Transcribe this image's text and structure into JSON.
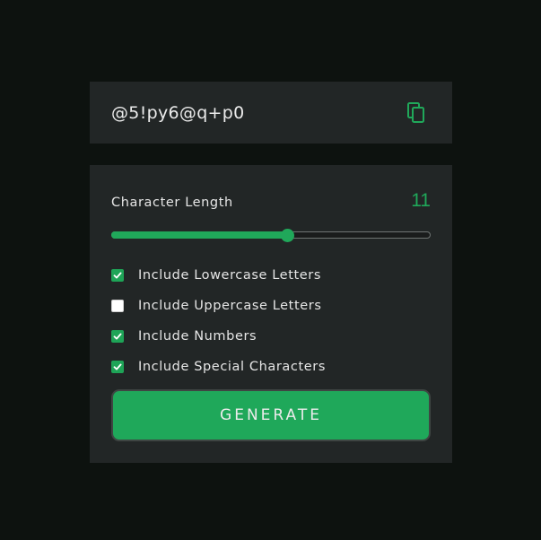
{
  "output": {
    "password": "@5!py6@q+p0",
    "copy_icon": "copy-icon"
  },
  "settings": {
    "length_label": "Character Length",
    "length_value": "11",
    "slider": {
      "min": 0,
      "max": 20,
      "value": 11
    },
    "options": [
      {
        "label": "Include Lowercase Letters",
        "checked": true
      },
      {
        "label": "Include Uppercase Letters",
        "checked": false
      },
      {
        "label": "Include Numbers",
        "checked": true
      },
      {
        "label": "Include Special Characters",
        "checked": true
      }
    ]
  },
  "generate_label": "GENERATE",
  "colors": {
    "accent": "#20a85a",
    "panel": "#222626",
    "background": "#0d120f"
  }
}
